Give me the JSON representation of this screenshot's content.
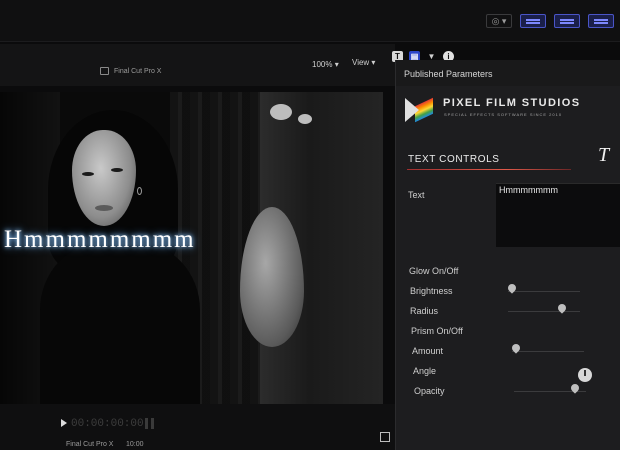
{
  "app": {
    "title": "Final Cut Pro X"
  },
  "viewer": {
    "zoom": "100%",
    "view_menu": "View",
    "overlay_text": "Hmmmmmmmm"
  },
  "transport": {
    "timecode": "00:00:00:00",
    "app_label": "Final Cut Pro X",
    "time": "10:00"
  },
  "inspector": {
    "header": "Published Parameters",
    "brand_name": "PIXEL FILM STUDIOS",
    "brand_tagline": "SPECIAL EFFECTS SOFTWARE SINCE 2010",
    "section_title": "TEXT CONTROLS",
    "text_label": "Text",
    "text_value": "Hmmmmmmm",
    "params": [
      {
        "label": "Glow On/Off",
        "type": "toggle"
      },
      {
        "label": "Brightness",
        "type": "slider",
        "value": 0.05
      },
      {
        "label": "Radius",
        "type": "slider",
        "value": 0.75
      },
      {
        "label": "Prism On/Off",
        "type": "toggle"
      },
      {
        "label": "Amount",
        "type": "slider",
        "value": 0.05
      },
      {
        "label": "Angle",
        "type": "dial"
      },
      {
        "label": "Opacity",
        "type": "slider",
        "value": 0.85
      }
    ]
  },
  "icons": {
    "text": "T",
    "info": "i"
  },
  "colors": {
    "accent_blue": "#2b46c9",
    "section_underline": "#e05a4a",
    "title_glow": "#5aa7ff"
  }
}
